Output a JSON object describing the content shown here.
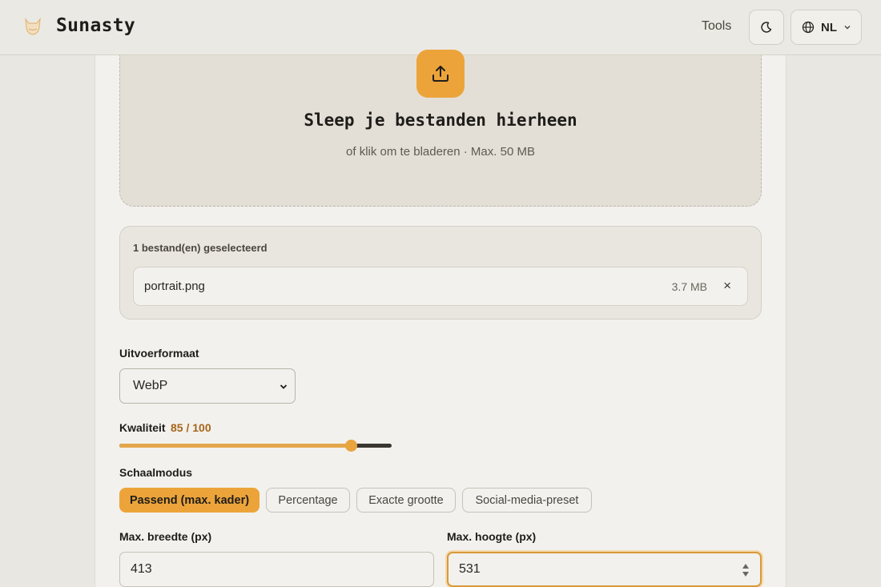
{
  "header": {
    "brand": "Sunasty",
    "nav_tools": "Tools",
    "language": "NL"
  },
  "dropzone": {
    "title": "Sleep je bestanden hierheen",
    "subtitle": "of klik om te bladeren · Max. 50 MB"
  },
  "files": {
    "count_label": "1 bestand(en) geselecteerd",
    "items": [
      {
        "name": "portrait.png",
        "size": "3.7 MB",
        "remove": "×"
      }
    ]
  },
  "output_format": {
    "label": "Uitvoerformaat",
    "selected": "WebP"
  },
  "quality": {
    "label": "Kwaliteit",
    "value_text": "85 / 100",
    "value": 85,
    "max": 100
  },
  "scale_mode": {
    "label": "Schaalmodus",
    "options": [
      "Passend (max. kader)",
      "Percentage",
      "Exacte grootte",
      "Social-media-preset"
    ],
    "active_index": 0
  },
  "max_width": {
    "label": "Max. breedte (px)",
    "value": "413"
  },
  "max_height": {
    "label": "Max. hoogte (px)",
    "value": "531"
  },
  "colors": {
    "accent": "#eca43a",
    "quality_text": "#a8641a"
  },
  "icons": {
    "logo": "fox-logo-icon",
    "theme": "moon-icon",
    "language": "globe-icon",
    "upload": "upload-icon",
    "remove": "close-icon",
    "select": "chevron-down-icon",
    "stepper": "stepper-icon"
  }
}
